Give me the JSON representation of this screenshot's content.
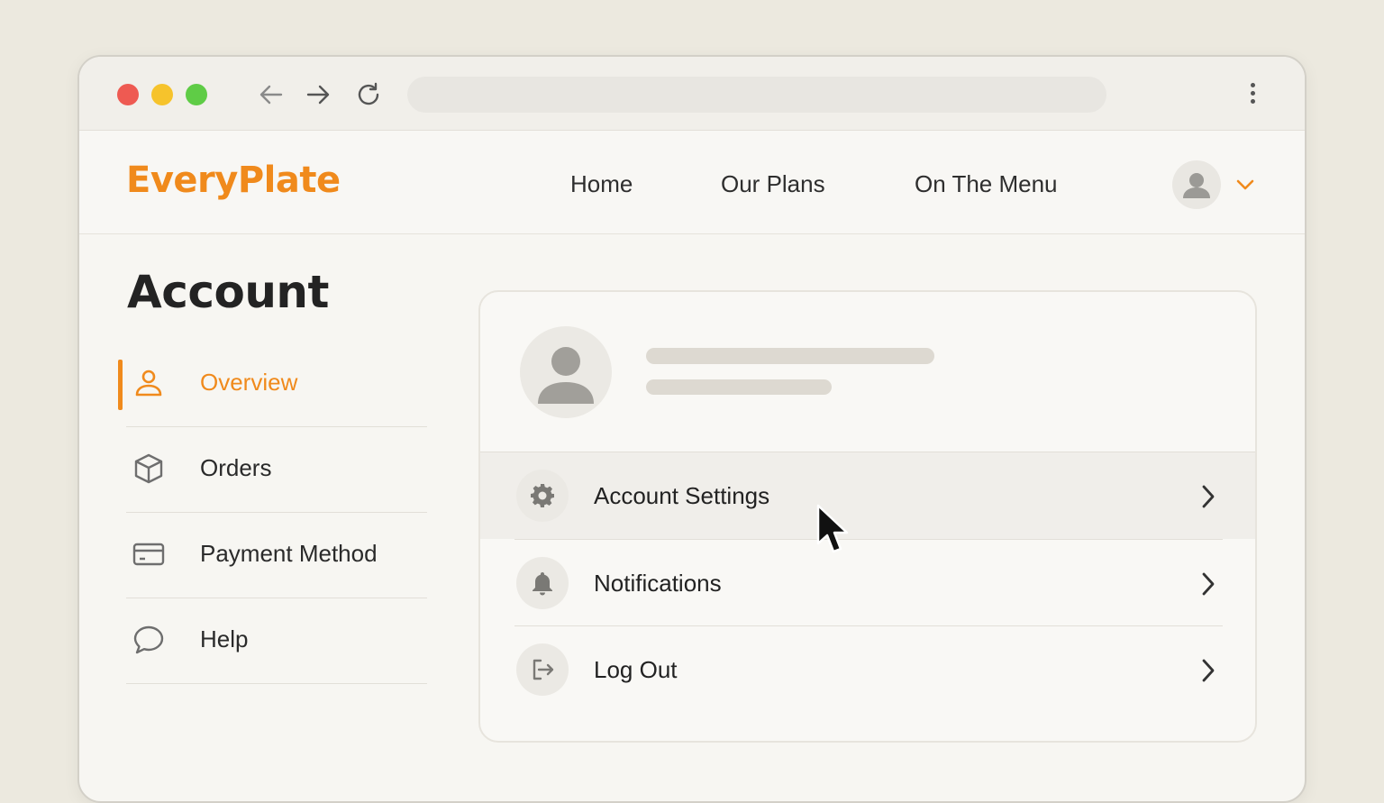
{
  "browser": {
    "traffic_lights": [
      "close",
      "minimize",
      "maximize"
    ],
    "address": ""
  },
  "header": {
    "logo": "EveryPlate",
    "nav": [
      "Home",
      "Our Plans",
      "On The Menu"
    ],
    "brand_color": "#f08a1c"
  },
  "sidebar": {
    "title": "Account",
    "items": [
      {
        "label": "Overview",
        "icon": "user-icon",
        "active": true
      },
      {
        "label": "Orders",
        "icon": "box-icon",
        "active": false
      },
      {
        "label": "Payment Method",
        "icon": "credit-card-icon",
        "active": false
      },
      {
        "label": "Help",
        "icon": "chat-bubble-icon",
        "active": false
      }
    ]
  },
  "card": {
    "menu": [
      {
        "label": "Account Settings",
        "icon": "gear-icon",
        "hovered": true
      },
      {
        "label": "Notifications",
        "icon": "bell-icon",
        "hovered": false
      },
      {
        "label": "Log Out",
        "icon": "logout-icon",
        "hovered": false
      }
    ]
  }
}
